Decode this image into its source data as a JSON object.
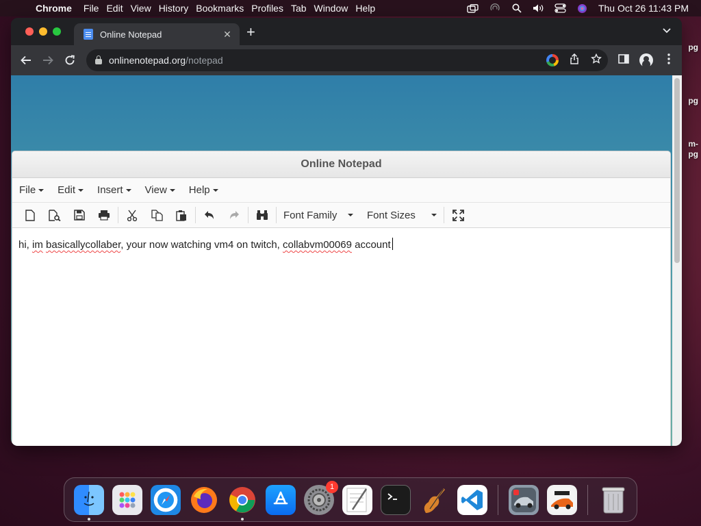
{
  "menubar": {
    "app_name": "Chrome",
    "items": [
      "File",
      "Edit",
      "View",
      "History",
      "Bookmarks",
      "Profiles",
      "Tab",
      "Window",
      "Help"
    ],
    "clock": "Thu Oct 26  11:43 PM"
  },
  "desktop": {
    "labels": [
      "pg",
      "pg",
      "m-",
      "pg"
    ]
  },
  "browser": {
    "tab_title": "Online Notepad",
    "tab_close": "✕",
    "new_tab": "+",
    "url_host": "onlinenotepad.org",
    "url_path": "/notepad"
  },
  "notepad": {
    "title": "Online Notepad",
    "menus": [
      "File",
      "Edit",
      "Insert",
      "View",
      "Help"
    ],
    "font_family_label": "Font Family",
    "font_sizes_label": "Font Sizes",
    "text_parts": [
      "hi, ",
      "im",
      " ",
      "basicallycollaber",
      ", your now watching vm4 on twitch, ",
      "collabvm00069",
      " account"
    ]
  },
  "dock": {
    "apps": [
      "finder",
      "launchpad",
      "safari",
      "firefox",
      "chrome",
      "app-store",
      "system-settings",
      "textedit",
      "terminal",
      "garageband",
      "vscode",
      "racing-game",
      "asphalt",
      "trash"
    ],
    "settings_badge": "1"
  },
  "colors": {
    "page_gradient_top": "#2f7ea9",
    "page_gradient_bottom": "#6daea5",
    "chrome_dark": "#35363a"
  }
}
